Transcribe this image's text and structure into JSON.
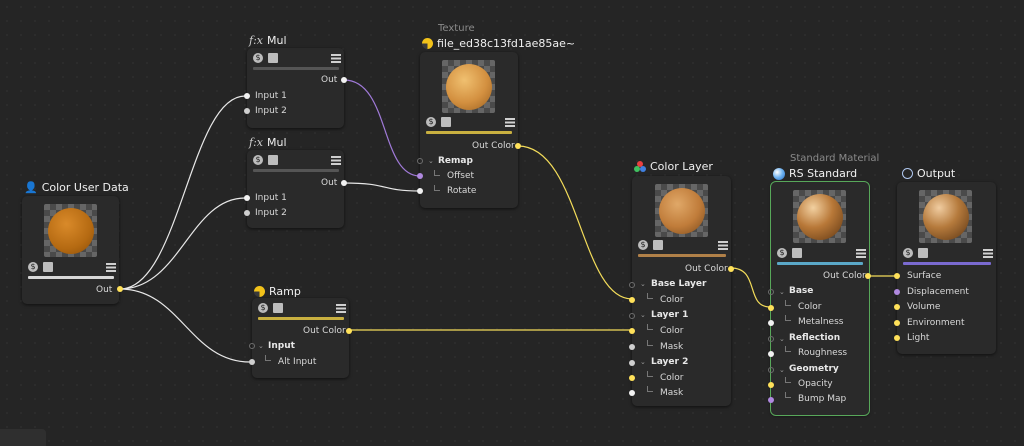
{
  "nodes": {
    "color_user_data": {
      "title": "Color User Data",
      "out": "Out"
    },
    "mul1": {
      "title": "Mul",
      "fx": "f:x",
      "out": "Out",
      "inputs": [
        "Input 1",
        "Input 2"
      ]
    },
    "mul2": {
      "title": "Mul",
      "fx": "f:x",
      "out": "Out",
      "inputs": [
        "Input 1",
        "Input 2"
      ]
    },
    "texture": {
      "subtitle": "Texture",
      "title": "file_ed38c13fd1ae85ae~",
      "out": "Out Color",
      "group": "Remap",
      "inputs": [
        "Offset",
        "Rotate"
      ]
    },
    "ramp": {
      "title": "Ramp",
      "out": "Out Color",
      "group": "Input",
      "inputs": [
        "Alt Input"
      ]
    },
    "color_layer": {
      "title": "Color Layer",
      "out": "Out Color",
      "base_layer": "Base Layer",
      "base_color": "Color",
      "layer1": "Layer 1",
      "l1_color": "Color",
      "l1_mask": "Mask",
      "layer2": "Layer 2",
      "l2_color": "Color",
      "l2_mask": "Mask"
    },
    "rs_standard": {
      "subtitle": "Standard Material",
      "title": "RS Standard",
      "out": "Out Color",
      "base": "Base",
      "color": "Color",
      "metalness": "Metalness",
      "reflection": "Reflection",
      "roughness": "Roughness",
      "geometry": "Geometry",
      "opacity": "Opacity",
      "bump_map": "Bump Map"
    },
    "output": {
      "title": "Output",
      "inputs": [
        "Surface",
        "Displacement",
        "Volume",
        "Environment",
        "Light"
      ]
    }
  },
  "colors": {
    "wire_white": "#e8e8e8",
    "wire_yellow": "#f3dc5a",
    "wire_purple": "#a07ad8",
    "bar_white": "#d8d8d8",
    "bar_gold": "#c9b040",
    "bar_brown": "#b08048",
    "bar_blue": "#5aa8c8",
    "bar_violet": "#7a6ad0",
    "selection": "#58a85a"
  },
  "icons": {
    "user_data": "user-data-icon",
    "fx": "formula-icon",
    "texture": "texture-icon",
    "ramp": "ramp-icon",
    "color_layer": "color-layer-icon",
    "rs_standard": "material-sphere-icon",
    "output": "output-icon"
  }
}
